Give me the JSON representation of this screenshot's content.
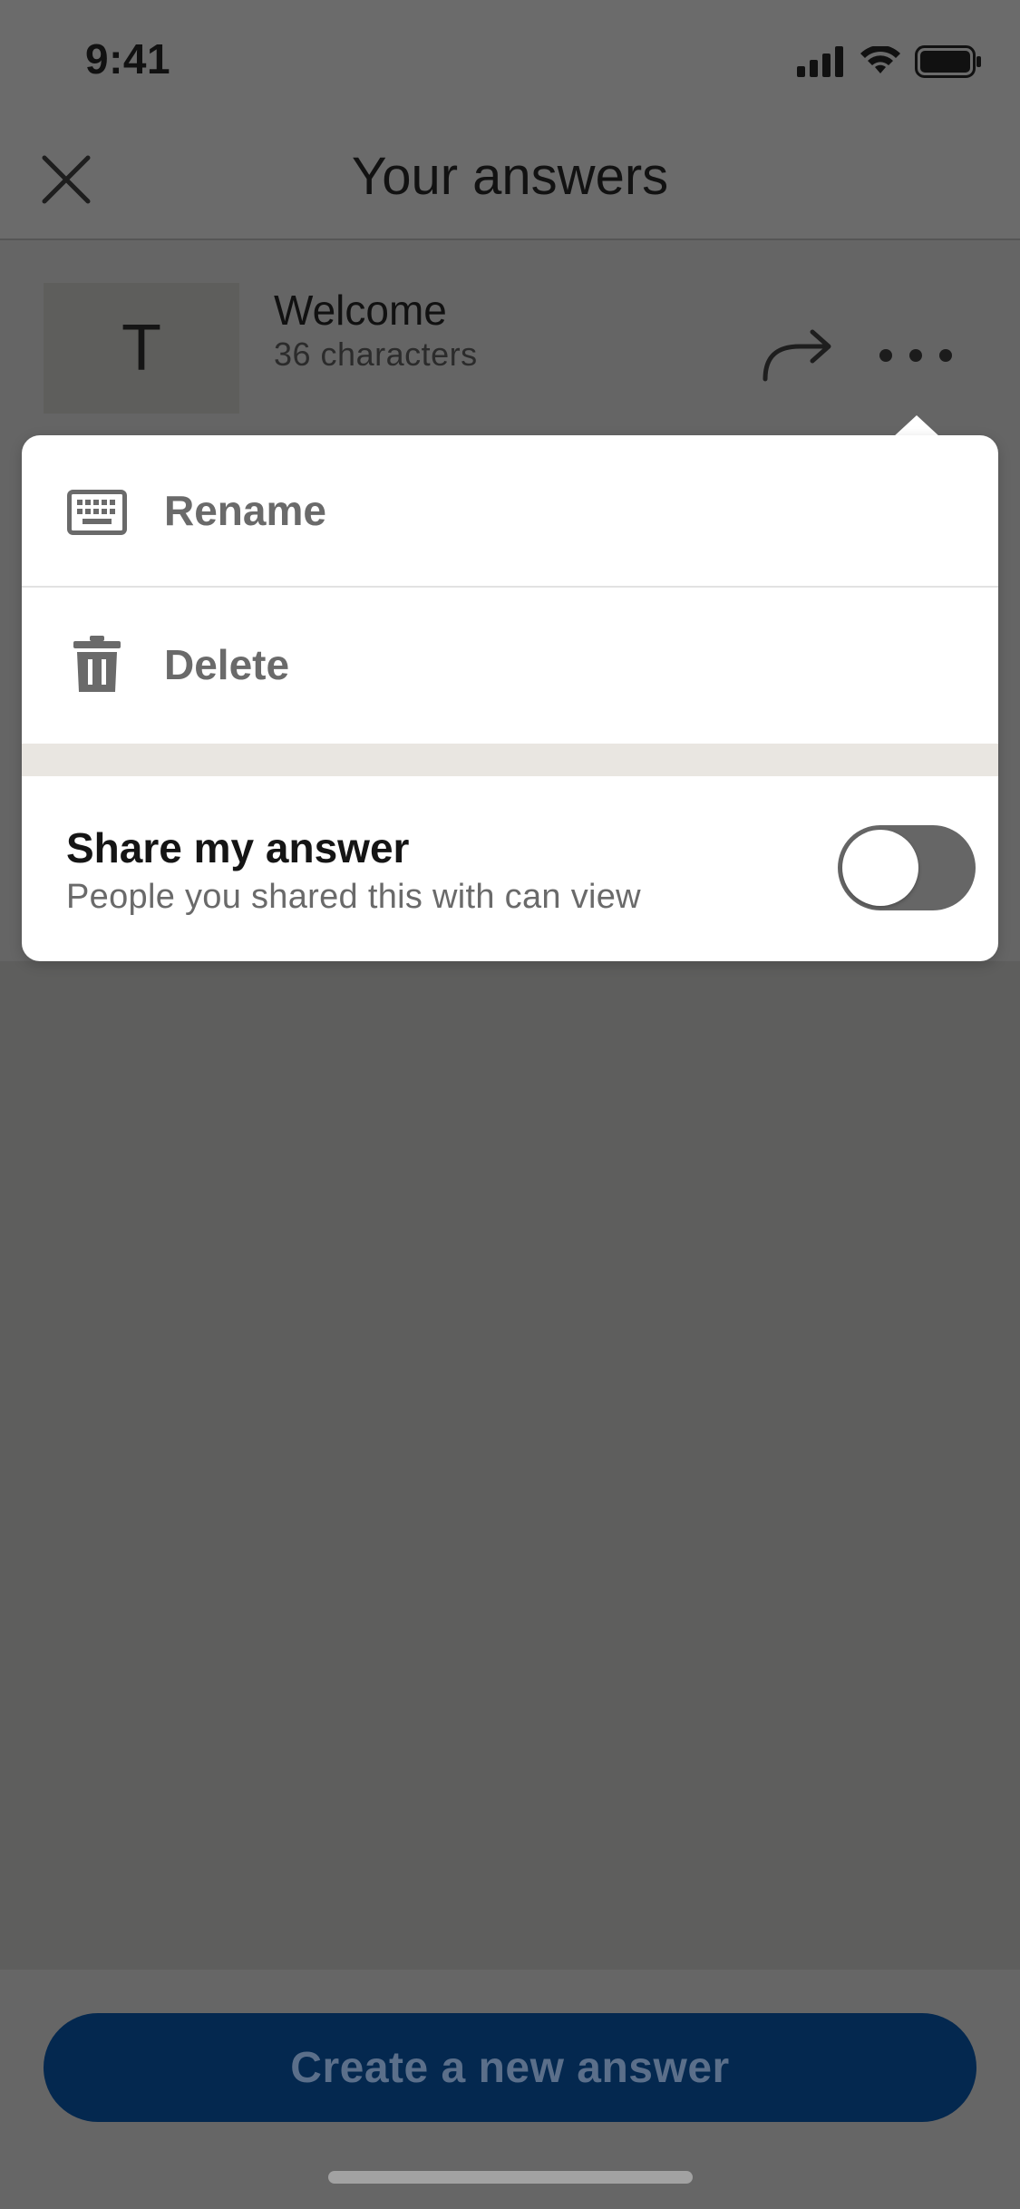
{
  "status_bar": {
    "time": "9:41",
    "icons": [
      "signal-icon",
      "wifi-icon",
      "battery-icon"
    ]
  },
  "header": {
    "title": "Your answers",
    "close_icon": "close-icon"
  },
  "answer": {
    "thumb_letter": "T",
    "title": "Welcome",
    "subtitle": "36 characters",
    "share_icon": "share-arrow-icon",
    "more_icon": "more-dots-icon"
  },
  "menu": {
    "items": [
      {
        "label": "Rename",
        "icon": "keyboard-icon"
      },
      {
        "label": "Delete",
        "icon": "trash-icon"
      }
    ],
    "share": {
      "title": "Share my answer",
      "description": "People you shared this with can view",
      "enabled": false
    }
  },
  "bottom": {
    "create_label": "Create a new answer"
  },
  "colors": {
    "primary_button": "#04284f",
    "overlay": "#656565",
    "separator": "#e9e6e1"
  }
}
